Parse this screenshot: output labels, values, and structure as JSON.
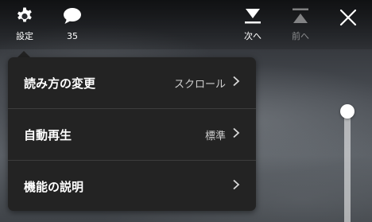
{
  "toolbar": {
    "settings_label": "設定",
    "comments_count": "35",
    "next_label": "次へ",
    "prev_label": "前へ"
  },
  "menu": {
    "items": [
      {
        "label": "読み方の変更",
        "value": "スクロール"
      },
      {
        "label": "自動再生",
        "value": "標準"
      },
      {
        "label": "機能の説明",
        "value": ""
      }
    ]
  },
  "page_slider": {
    "position": 0.0
  },
  "colors": {
    "menu_background": "#232323",
    "text": "#ffffff",
    "secondary_text": "#cfcfcf"
  }
}
